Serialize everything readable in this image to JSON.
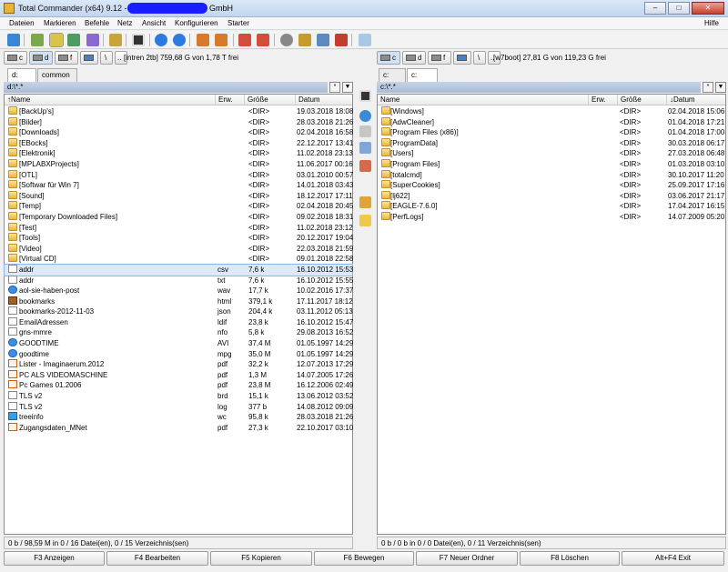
{
  "window": {
    "title": "Total Commander (x64) 9.12 -",
    "title_suffix": "GmbH",
    "controls": [
      "–",
      "□",
      "✕"
    ]
  },
  "menu": {
    "items": [
      "Dateien",
      "Markieren",
      "Befehle",
      "Netz",
      "Ansicht",
      "Konfigurieren",
      "Starter"
    ],
    "help": "Hilfe"
  },
  "left": {
    "drives": [
      "c",
      "d",
      "f",
      "\\",
      ".."
    ],
    "drive_info": "[intren 2tb]  759,68 G von 1,78 T frei",
    "tabs": [
      "d:",
      "common"
    ],
    "path": "d:\\*.*",
    "columns": [
      "↑Name",
      "Erw.",
      "Größe",
      "Datum"
    ],
    "rows": [
      {
        "name": "[BackUp's]",
        "ext": "",
        "size": "<DIR>",
        "date": "19.03.2018 18:08",
        "icon": "folder"
      },
      {
        "name": "[Bilder]",
        "ext": "",
        "size": "<DIR>",
        "date": "28.03.2018 21:26",
        "icon": "folder"
      },
      {
        "name": "[Downloads]",
        "ext": "",
        "size": "<DIR>",
        "date": "02.04.2018 16:58",
        "icon": "folder"
      },
      {
        "name": "[EBocks]",
        "ext": "",
        "size": "<DIR>",
        "date": "22.12.2017 13:41",
        "icon": "folder"
      },
      {
        "name": "[Elektronik]",
        "ext": "",
        "size": "<DIR>",
        "date": "11.02.2018 23:13",
        "icon": "folder"
      },
      {
        "name": "[MPLABXProjects]",
        "ext": "",
        "size": "<DIR>",
        "date": "11.06.2017 00:16",
        "icon": "folder"
      },
      {
        "name": "[OTL]",
        "ext": "",
        "size": "<DIR>",
        "date": "03.01.2010 00:57",
        "icon": "folder"
      },
      {
        "name": "[Softwar für Win 7]",
        "ext": "",
        "size": "<DIR>",
        "date": "14.01.2018 03:43",
        "icon": "folder"
      },
      {
        "name": "[Sound]",
        "ext": "",
        "size": "<DIR>",
        "date": "18.12.2017 17:11",
        "icon": "folder"
      },
      {
        "name": "[Temp]",
        "ext": "",
        "size": "<DIR>",
        "date": "02.04.2018 20:45",
        "icon": "folder"
      },
      {
        "name": "[Temporary Downloaded Files]",
        "ext": "",
        "size": "<DIR>",
        "date": "09.02.2018 18:31",
        "icon": "folder"
      },
      {
        "name": "[Test]",
        "ext": "",
        "size": "<DIR>",
        "date": "11.02.2018 23:12",
        "icon": "folder"
      },
      {
        "name": "[Tools]",
        "ext": "",
        "size": "<DIR>",
        "date": "20.12.2017 19:04",
        "icon": "folder"
      },
      {
        "name": "[Video]",
        "ext": "",
        "size": "<DIR>",
        "date": "22.03.2018 21:59",
        "icon": "folder"
      },
      {
        "name": "[Virtual CD]",
        "ext": "",
        "size": "<DIR>",
        "date": "09.01.2018 22:58",
        "icon": "folder"
      },
      {
        "name": "addr",
        "ext": "csv",
        "size": "7,6 k",
        "date": "16.10.2012 15:53",
        "icon": "file",
        "selected": true
      },
      {
        "name": "addr",
        "ext": "txt",
        "size": "7,6 k",
        "date": "16.10.2012 15:55",
        "icon": "file"
      },
      {
        "name": "aol-sie-haben-post",
        "ext": "wav",
        "size": "17,7 k",
        "date": "10.02.2016 17:37",
        "icon": "media"
      },
      {
        "name": "bookmarks",
        "ext": "html",
        "size": "379,1 k",
        "date": "17.11.2017 18:12",
        "icon": "bm"
      },
      {
        "name": "bookmarks-2012-11-03",
        "ext": "json",
        "size": "204,4 k",
        "date": "03.11.2012 05:13",
        "icon": "file"
      },
      {
        "name": "EmailAdressen",
        "ext": "ldif",
        "size": "23,8 k",
        "date": "16.10.2012 15:47",
        "icon": "file"
      },
      {
        "name": "gns-mmre",
        "ext": "nfo",
        "size": "5,8 k",
        "date": "29.08.2013 16:52",
        "icon": "file"
      },
      {
        "name": "GOODTIME",
        "ext": "AVI",
        "size": "37,4 M",
        "date": "01.05.1997 14:29",
        "icon": "media"
      },
      {
        "name": "goodtime",
        "ext": "mpg",
        "size": "35,0 M",
        "date": "01.05.1997 14:29",
        "icon": "media"
      },
      {
        "name": "Lister - Imaginaerum.2012",
        "ext": "pdf",
        "size": "32,2 k",
        "date": "12.07.2013 17:29",
        "icon": "pdf"
      },
      {
        "name": "PC ALS VIDEOMASCHINE",
        "ext": "pdf",
        "size": "1,3 M",
        "date": "14.07.2005 17:26",
        "icon": "pdf"
      },
      {
        "name": "Pc Games 01.2006",
        "ext": "pdf",
        "size": "23,8 M",
        "date": "16.12.2006 02:49",
        "icon": "pdf"
      },
      {
        "name": "TLS v2",
        "ext": "brd",
        "size": "15,1 k",
        "date": "13.06.2012 03:52",
        "icon": "file"
      },
      {
        "name": "TLS v2",
        "ext": "log",
        "size": "377 b",
        "date": "14.08.2012 09:09",
        "icon": "file"
      },
      {
        "name": "treeinfo",
        "ext": "wc",
        "size": "95,8 k",
        "date": "28.03.2018 21:26",
        "icon": "web"
      },
      {
        "name": "Zugangsdaten_MNet",
        "ext": "pdf",
        "size": "27,3 k",
        "date": "22.10.2017 03:10",
        "icon": "pdf"
      }
    ],
    "status": "0 b / 98,59 M in 0 / 16 Datei(en), 0 / 15 Verzeichnis(sen)"
  },
  "right": {
    "drives": [
      "c",
      "d",
      "f",
      "\\",
      ".."
    ],
    "drive_info": "[w7boot]  27,81 G von 119,23 G frei",
    "tabs": [
      "c:",
      "c:"
    ],
    "path": "c:\\*.*",
    "columns": [
      "Name",
      "Erw.",
      "Größe",
      "↓Datum"
    ],
    "rows": [
      {
        "name": "[Windows]",
        "ext": "",
        "size": "<DIR>",
        "date": "02.04.2018 15:06",
        "icon": "folder"
      },
      {
        "name": "[AdwCleaner]",
        "ext": "",
        "size": "<DIR>",
        "date": "01.04.2018 17:21",
        "icon": "folder"
      },
      {
        "name": "[Program Files (x86)]",
        "ext": "",
        "size": "<DIR>",
        "date": "01.04.2018 17:00",
        "icon": "folder"
      },
      {
        "name": "[ProgramData]",
        "ext": "",
        "size": "<DIR>",
        "date": "30.03.2018 06:17",
        "icon": "folder"
      },
      {
        "name": "[Users]",
        "ext": "",
        "size": "<DIR>",
        "date": "27.03.2018 06:48",
        "icon": "folder"
      },
      {
        "name": "[Program Files]",
        "ext": "",
        "size": "<DIR>",
        "date": "01.03.2018 03:10",
        "icon": "folder"
      },
      {
        "name": "[totalcmd]",
        "ext": "",
        "size": "<DIR>",
        "date": "30.10.2017 11:20",
        "icon": "folder"
      },
      {
        "name": "[SuperCookies]",
        "ext": "",
        "size": "<DIR>",
        "date": "25.09.2017 17:16",
        "icon": "folder"
      },
      {
        "name": "[lj622]",
        "ext": "",
        "size": "<DIR>",
        "date": "03.06.2017 21:17",
        "icon": "folder"
      },
      {
        "name": "[EAGLE-7.6.0]",
        "ext": "",
        "size": "<DIR>",
        "date": "17.04.2017 16:15",
        "icon": "folder"
      },
      {
        "name": "[PerfLogs]",
        "ext": "",
        "size": "<DIR>",
        "date": "14.07.2009 05:20",
        "icon": "folder"
      }
    ],
    "status": "0 b / 0 b in 0 / 0 Datei(en), 0 / 11 Verzeichnis(sen)"
  },
  "fkeys": [
    "F3 Anzeigen",
    "F4 Bearbeiten",
    "F5 Kopieren",
    "F6 Bewegen",
    "F7 Neuer Ordner",
    "F8 Löschen",
    "Alt+F4 Exit"
  ],
  "path_buttons": [
    "*",
    "▼"
  ]
}
